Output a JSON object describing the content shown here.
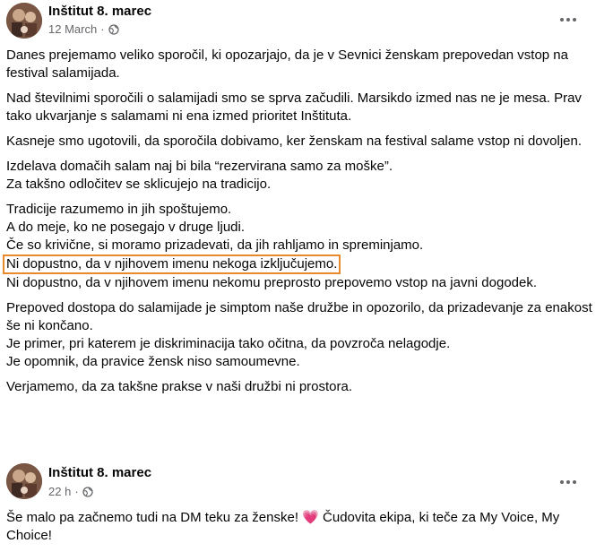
{
  "posts": [
    {
      "author": "Inštitut 8. marec",
      "time": "12 March",
      "paragraphs": [
        [
          "Danes prejemamo veliko sporočil, ki opozarjajo, da je v Sevnici ženskam prepovedan vstop na festival salamijada."
        ],
        [
          "Nad številnimi sporočili o salamijadi smo se sprva začudili. Marsikdo izmed nas ne je mesa. Prav tako ukvarjanje s salamami ni ena izmed prioritet Inštituta."
        ],
        [
          "Kasneje smo ugotovili, da sporočila dobivamo, ker ženskam na festival salame vstop ni dovoljen."
        ],
        [
          "Izdelava domačih salam naj bi bila “rezervirana samo za moške”.",
          "Za takšno odločitev se sklicujejo na tradicijo."
        ],
        [
          "Tradicije razumemo in jih spoštujemo.",
          "A do meje, ko ne posegajo v druge ljudi.",
          "Če so krivične, si moramo prizadevati, da jih rahljamo in spreminjamo.",
          "Ni dopustno, da v njihovem imenu nekoga izključujemo.",
          "Ni dopustno, da v njihovem imenu nekomu preprosto prepovemo vstop na javni dogodek."
        ],
        [
          "Prepoved dostopa do salamijade je simptom naše družbe in opozorilo, da prizadevanje za enakost še ni končano.",
          "Je primer, pri katerem je diskriminacija tako očitna, da povzroča nelagodje.",
          "Je opomnik, da pravice žensk niso samoumevne."
        ],
        [
          "Verjamemo, da za takšne prakse v naši družbi ni prostora."
        ]
      ]
    },
    {
      "author": "Inštitut 8. marec",
      "time": "22 h",
      "paragraphs": [
        [
          "Še malo pa začnemo tudi na DM teku za ženske! 💗 Čudovita ekipa, ki teče za My Voice, My Choice!"
        ]
      ]
    }
  ],
  "icons": {
    "globe": "globe-icon",
    "more": "more-options-icon"
  },
  "colors": {
    "highlight_border": "#e8892b",
    "meta_gray": "#65676b"
  }
}
